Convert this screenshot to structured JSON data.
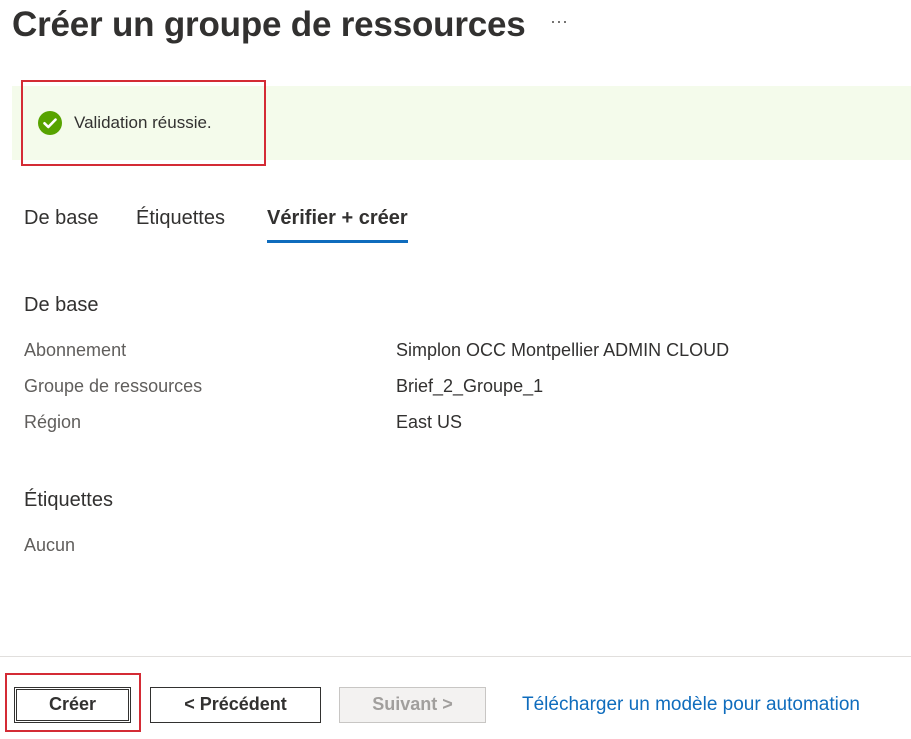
{
  "header": {
    "title": "Créer un groupe de ressources",
    "more_label": "···"
  },
  "validation": {
    "status": "success",
    "message": "Validation réussie.",
    "icon": "check-circle-icon",
    "color": "#57a300",
    "background": "#f4fbeb"
  },
  "tabs": [
    {
      "label": "De base",
      "active": false
    },
    {
      "label": "Étiquettes",
      "active": false
    },
    {
      "label": "Vérifier + créer",
      "active": true
    }
  ],
  "summary": {
    "basics": {
      "title": "De base",
      "fields": [
        {
          "label": "Abonnement",
          "value": "Simplon OCC Montpellier ADMIN CLOUD"
        },
        {
          "label": "Groupe de ressources",
          "value": "Brief_2_Groupe_1"
        },
        {
          "label": "Région",
          "value": "East US"
        }
      ]
    },
    "tags": {
      "title": "Étiquettes",
      "empty_text": "Aucun"
    }
  },
  "footer": {
    "create_label": "Créer",
    "previous_label": "< Précédent",
    "next_label": "Suivant >",
    "next_disabled": true,
    "download_link": "Télécharger un modèle pour automation"
  },
  "colors": {
    "accent": "#0f6cbd",
    "highlight": "#d42b35",
    "text": "#323130",
    "secondary_text": "#605e5c"
  }
}
